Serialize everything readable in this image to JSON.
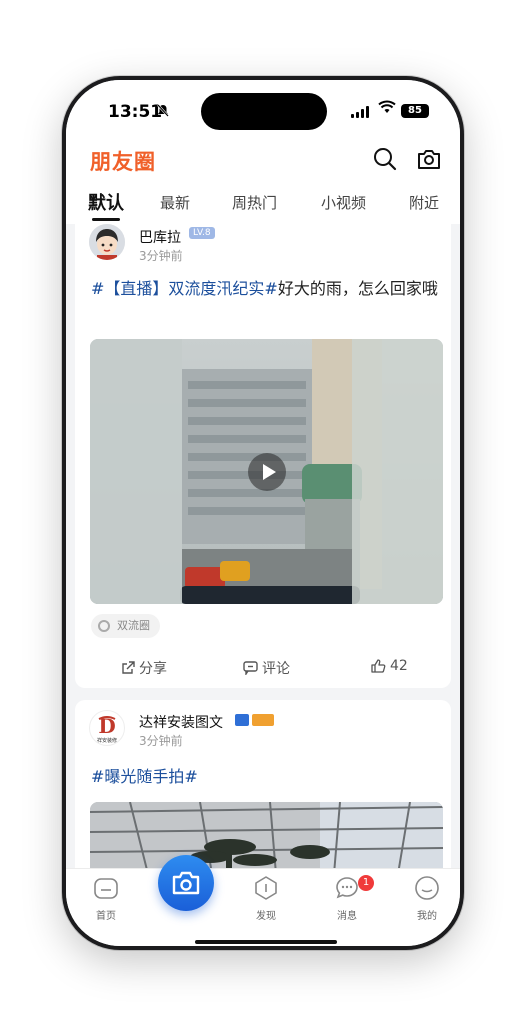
{
  "status": {
    "time": "13:51",
    "battery": "85"
  },
  "header": {
    "title": "朋友圈"
  },
  "tabs": [
    "默认",
    "最新",
    "周热门",
    "小视频",
    "附近"
  ],
  "posts": [
    {
      "user": "巴库拉",
      "level": "LV.8",
      "time": "3分钟前",
      "topic": "#【直播】双流度汛纪实#",
      "text": "好大的雨，怎么回家哦",
      "circle": "双流圈",
      "actions": {
        "share": "分享",
        "comment": "评论",
        "likes": "42"
      }
    },
    {
      "user": "达祥安装图文",
      "time": "3分钟前",
      "topic": "#曝光随手拍#",
      "avatar_text": "D",
      "avatar_caption": "祥安装修"
    }
  ],
  "tabbar": {
    "home": "首页",
    "discover": "发现",
    "messages": "消息",
    "messages_badge": "1",
    "mine": "我的"
  },
  "colors": {
    "brand": "#f0602a",
    "topic": "#1c4f9c",
    "camera": "#1a5fd8",
    "badge": "#f03a3a"
  }
}
